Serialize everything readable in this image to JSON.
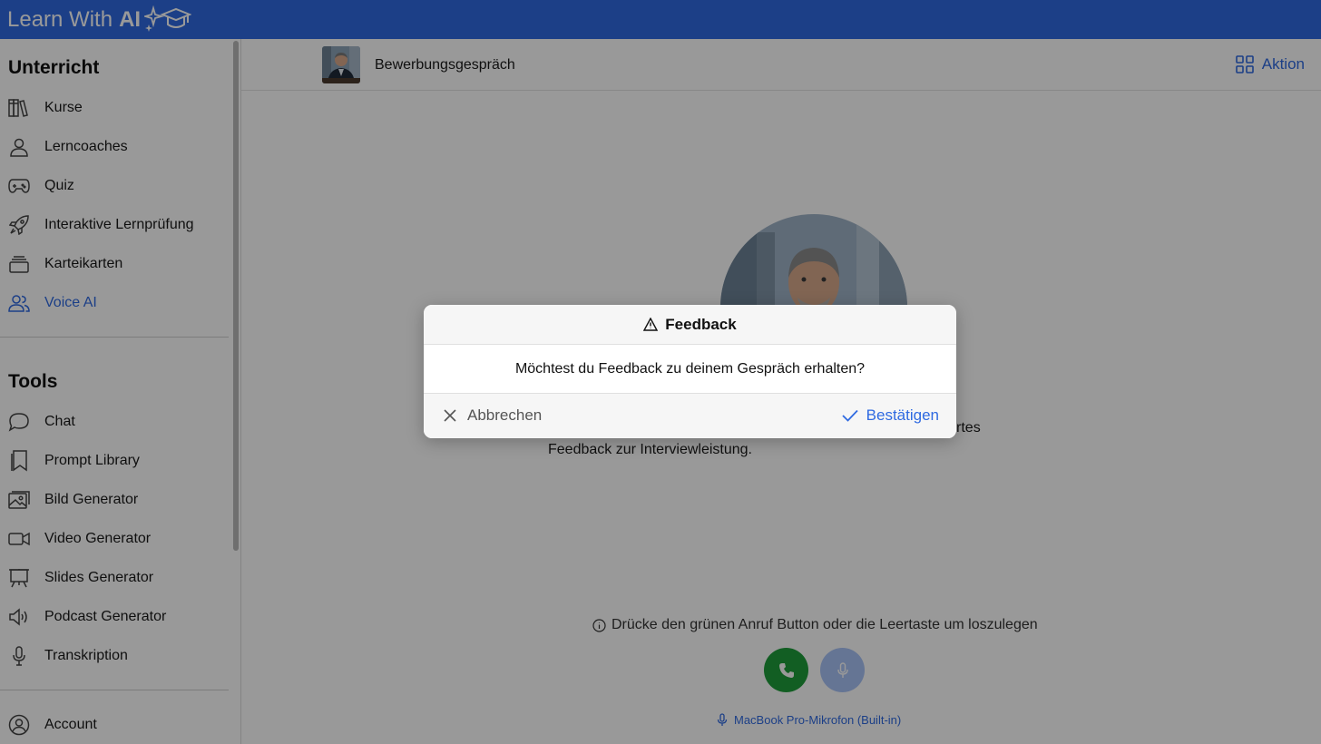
{
  "app": {
    "title_prefix": "Learn With",
    "title_ai": "AI"
  },
  "sidebar": {
    "section_teaching": "Unterricht",
    "teaching_items": [
      {
        "label": "Kurse",
        "icon": "books-icon"
      },
      {
        "label": "Lerncoaches",
        "icon": "person-icon"
      },
      {
        "label": "Quiz",
        "icon": "gamepad-icon"
      },
      {
        "label": "Interaktive Lernprüfung",
        "icon": "rocket-icon"
      },
      {
        "label": "Karteikarten",
        "icon": "cards-stack-icon"
      },
      {
        "label": "Voice AI",
        "icon": "users-icon",
        "active": true
      }
    ],
    "section_tools": "Tools",
    "tool_items": [
      {
        "label": "Chat",
        "icon": "chat-bubble-icon"
      },
      {
        "label": "Prompt Library",
        "icon": "bookmark-icon"
      },
      {
        "label": "Bild Generator",
        "icon": "image-icon"
      },
      {
        "label": "Video Generator",
        "icon": "video-camera-icon"
      },
      {
        "label": "Slides Generator",
        "icon": "presentation-icon"
      },
      {
        "label": "Podcast Generator",
        "icon": "speaker-icon"
      },
      {
        "label": "Transkription",
        "icon": "microphone-icon"
      }
    ],
    "account": {
      "label": "Account",
      "icon": "user-circle-icon"
    }
  },
  "header": {
    "conversation_title": "Bewerbungsgespräch",
    "action_label": "Aktion"
  },
  "main": {
    "description": "basierten, fachlichen und Stressfragen. Gibt am Ende strukturiertes Feedback zur Interviewleistung.",
    "hint": "Drücke den grünen Anruf Button oder die Leertaste um loszulegen",
    "device_label": "MacBook Pro-Mikrofon (Built-in)"
  },
  "modal": {
    "title": "Feedback",
    "message": "Möchtest du Feedback zu deinem Gespräch erhalten?",
    "cancel_label": "Abbrechen",
    "confirm_label": "Bestätigen"
  },
  "colors": {
    "brand_blue": "#2f6ae1",
    "call_green": "#1f9d3b",
    "mic_blue": "#a9c3f7"
  }
}
